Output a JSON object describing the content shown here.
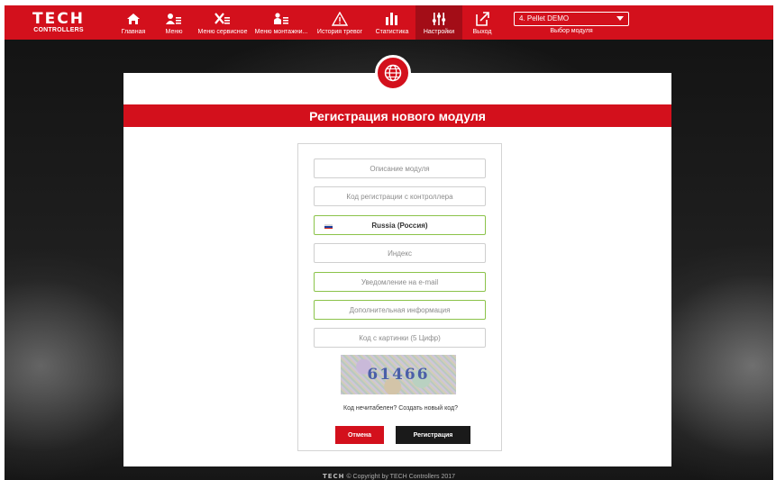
{
  "colors": {
    "brand_red": "#d3101c",
    "active_red": "#a30d17",
    "valid_border": "#8bc34a",
    "dark_button": "#1a1a1a"
  },
  "logo": {
    "main": "TECH",
    "sub": "CONTROLLERS"
  },
  "nav": [
    {
      "label": "Главная",
      "icon": "home-icon"
    },
    {
      "label": "Меню",
      "icon": "user-menu-icon"
    },
    {
      "label": "Меню сервисное",
      "icon": "tools-icon"
    },
    {
      "label": "Меню монтажни...",
      "icon": "installer-icon"
    },
    {
      "label": "История тревог",
      "icon": "warning-icon"
    },
    {
      "label": "Статистика",
      "icon": "statistics-icon"
    },
    {
      "label": "Настройки",
      "icon": "sliders-icon",
      "active": true
    },
    {
      "label": "Выход",
      "icon": "exit-icon"
    }
  ],
  "module_select": {
    "value": "4. Pellet DEMO",
    "caption": "Выбор модуля"
  },
  "card": {
    "title": "Регистрация нового модуля",
    "icon": "globe-icon"
  },
  "form": {
    "description_placeholder": "Описание модуля",
    "reg_code_placeholder": "Код регистрации с контроллера",
    "country_value": "Russia (Россия)",
    "postcode_placeholder": "Индекс",
    "email_placeholder": "Уведомление на e-mail",
    "extra_info_placeholder": "Дополнительная информация",
    "captcha_input_placeholder": "Код с картинки (5 Цифр)",
    "captcha_text": "61466",
    "new_code_link": "Код нечитабелен? Создать новый код?",
    "cancel_label": "Отмена",
    "register_label": "Регистрация"
  },
  "footer": {
    "logo": "TECH",
    "text": "© Copyright by TECH Controllers 2017"
  }
}
